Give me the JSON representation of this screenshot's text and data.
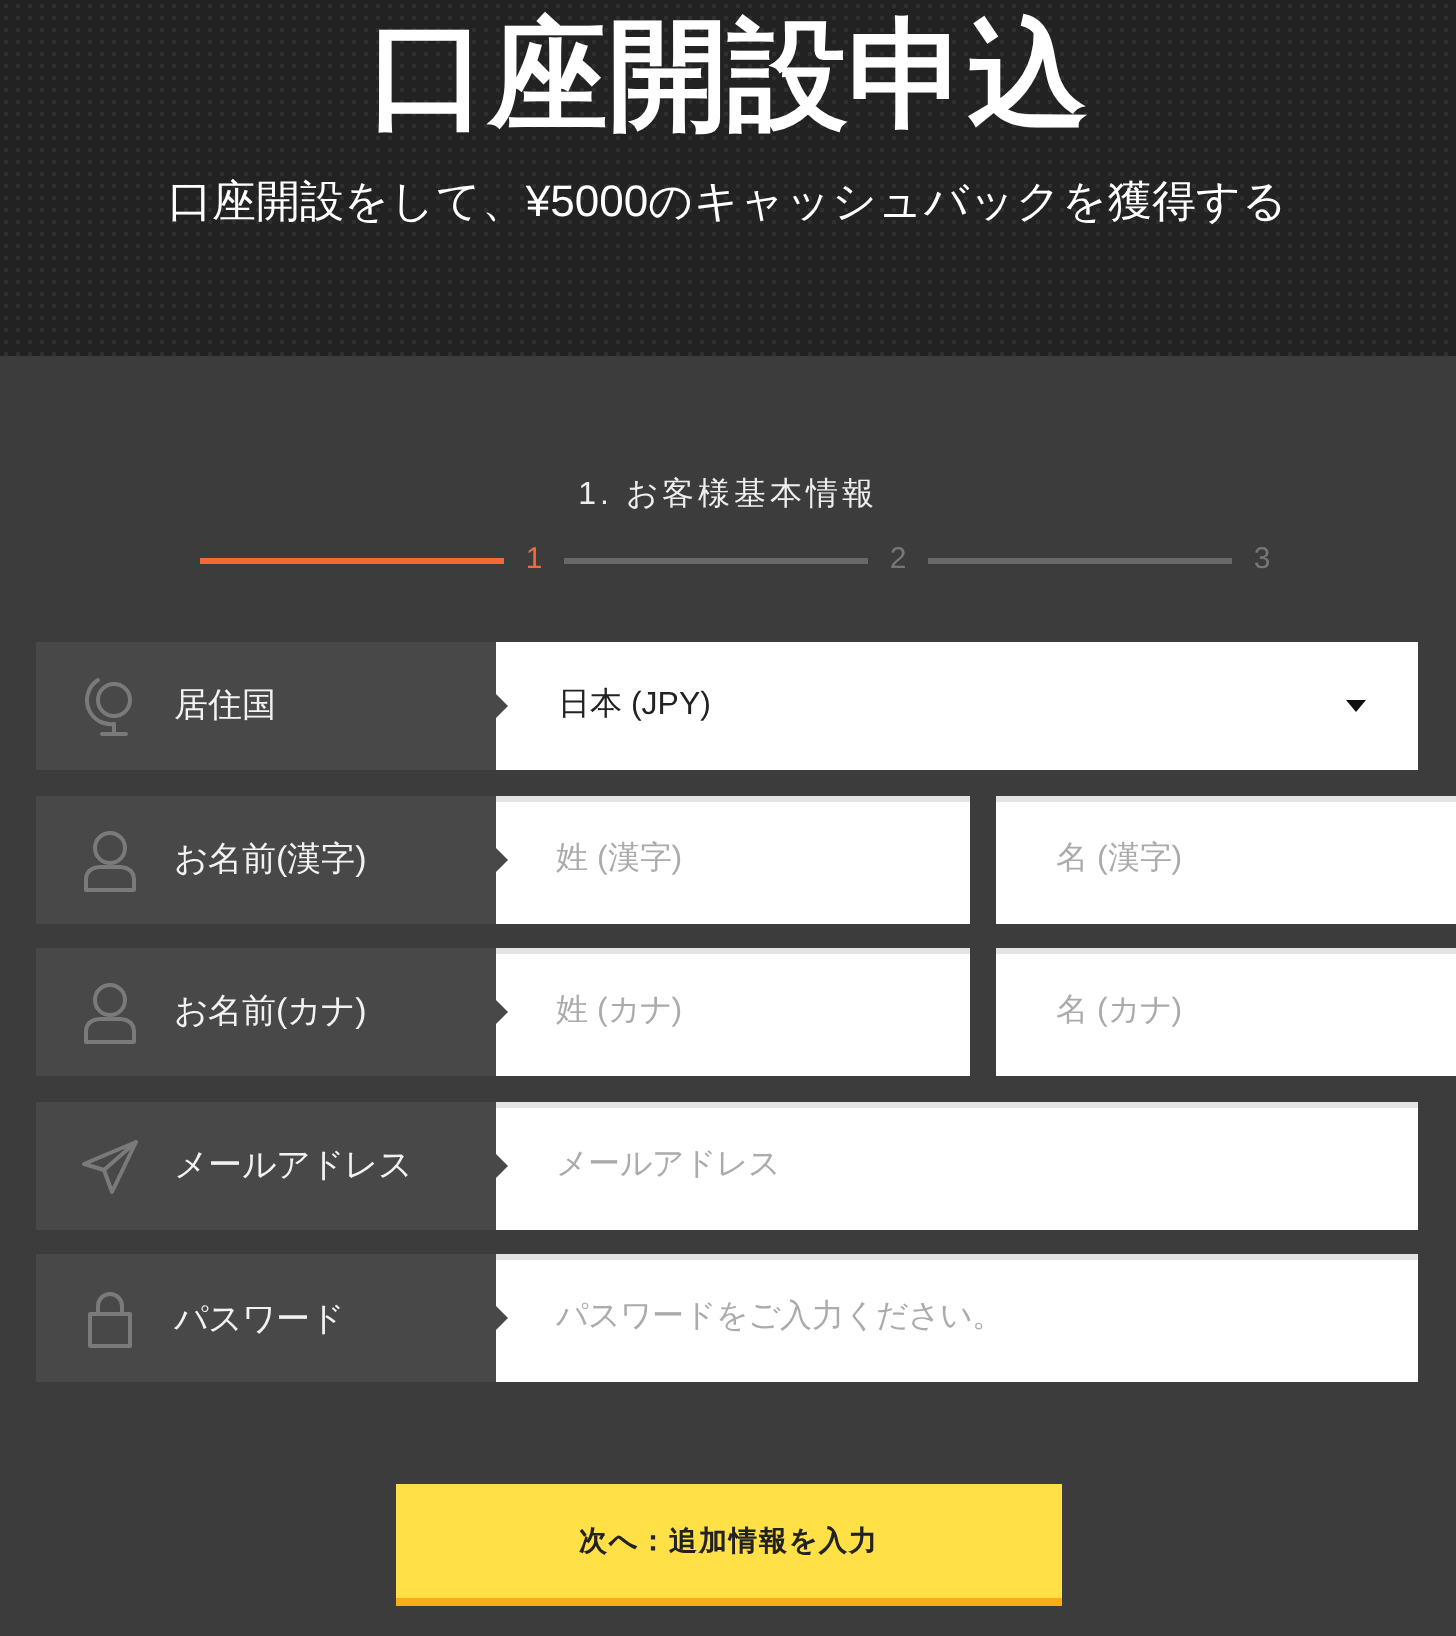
{
  "header": {
    "title": "口座開設申込",
    "subtitle": "口座開設をして、¥5000のキャッシュバックを獲得する"
  },
  "progress": {
    "title": "1. お客様基本情報",
    "steps": [
      {
        "label": "1",
        "selected": true
      },
      {
        "label": "2",
        "selected": false
      },
      {
        "label": "3",
        "selected": false
      }
    ]
  },
  "fields": [
    {
      "kind": "select",
      "label": "居住国",
      "value": "日本 (JPY)"
    },
    {
      "kind": "name",
      "label": "お名前(漢字)",
      "inputs": [
        {
          "placeholder": "姓 (漢字)"
        },
        {
          "placeholder": "名 (漢字)"
        }
      ]
    },
    {
      "kind": "name",
      "label": "お名前(カナ)",
      "inputs": [
        {
          "placeholder": "姓 (カナ)"
        },
        {
          "placeholder": "名 (カナ)"
        }
      ]
    },
    {
      "kind": "email",
      "label": "メールアドレス",
      "placeholder": "メールアドレス"
    },
    {
      "kind": "password",
      "label": "パスワード",
      "placeholder": "パスワードをご入力ください。"
    }
  ],
  "submit_button": {
    "label": "次へ：追加情報を入力"
  }
}
